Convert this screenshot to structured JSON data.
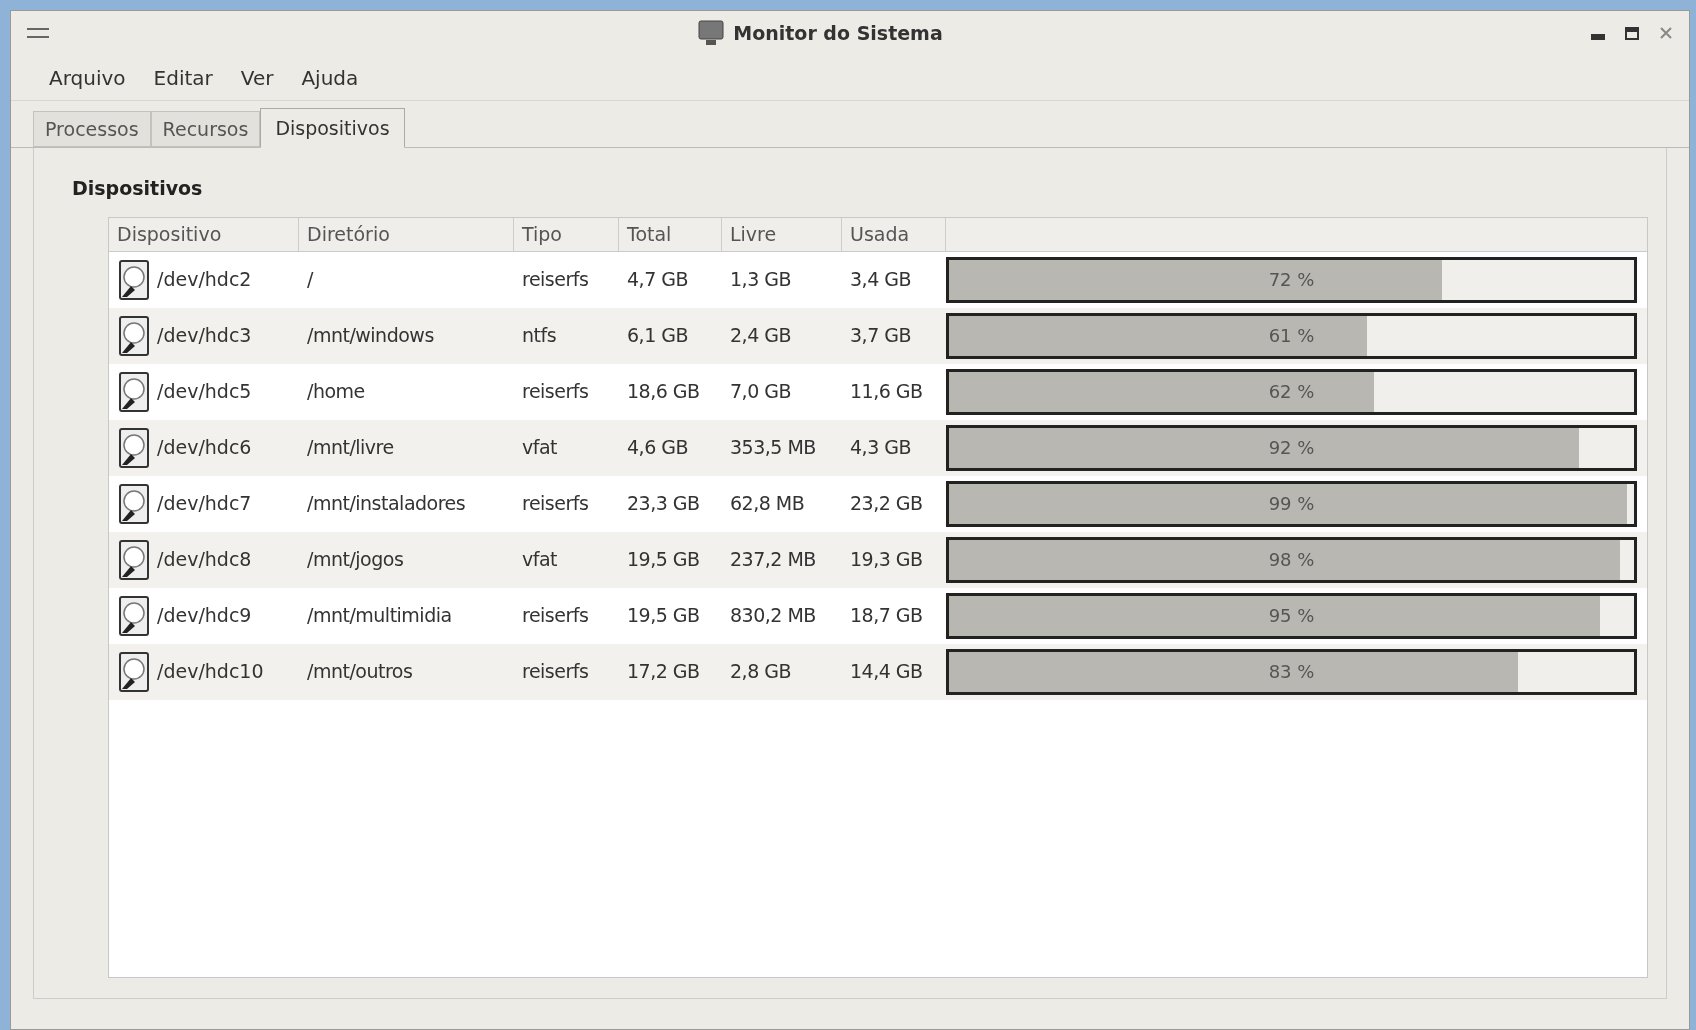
{
  "window": {
    "title": "Monitor do Sistema"
  },
  "menu": [
    "Arquivo",
    "Editar",
    "Ver",
    "Ajuda"
  ],
  "tabs": [
    {
      "label": "Processos",
      "selected": false
    },
    {
      "label": "Recursos",
      "selected": false
    },
    {
      "label": "Dispositivos",
      "selected": true
    }
  ],
  "section_title": "Dispositivos",
  "table": {
    "columns": [
      "Dispositivo",
      "Diretório",
      "Tipo",
      "Total",
      "Livre",
      "Usada"
    ],
    "rows": [
      {
        "device": "/dev/hdc2",
        "directory": "/",
        "type": "reiserfs",
        "total": "4,7 GB",
        "free": "1,3 GB",
        "used": "3,4 GB",
        "level": 0.72,
        "percent": "72 %"
      },
      {
        "device": "/dev/hdc3",
        "directory": "/mnt/windows",
        "type": "ntfs",
        "total": "6,1 GB",
        "free": "2,4 GB",
        "used": "3,7 GB",
        "level": 0.61,
        "percent": "61 %"
      },
      {
        "device": "/dev/hdc5",
        "directory": "/home",
        "type": "reiserfs",
        "total": "18,6 GB",
        "free": "7,0 GB",
        "used": "11,6 GB",
        "level": 0.62,
        "percent": "62 %"
      },
      {
        "device": "/dev/hdc6",
        "directory": "/mnt/livre",
        "type": "vfat",
        "total": "4,6 GB",
        "free": "353,5 MB",
        "used": "4,3 GB",
        "level": 0.92,
        "percent": "92 %"
      },
      {
        "device": "/dev/hdc7",
        "directory": "/mnt/instaladores",
        "type": "reiserfs",
        "total": "23,3 GB",
        "free": "62,8 MB",
        "used": "23,2 GB",
        "level": 0.99,
        "percent": "99 %"
      },
      {
        "device": "/dev/hdc8",
        "directory": "/mnt/jogos",
        "type": "vfat",
        "total": "19,5 GB",
        "free": "237,2 MB",
        "used": "19,3 GB",
        "level": 0.98,
        "percent": "98 %"
      },
      {
        "device": "/dev/hdc9",
        "directory": "/mnt/multimidia",
        "type": "reiserfs",
        "total": "19,5 GB",
        "free": "830,2 MB",
        "used": "18,7 GB",
        "level": 0.95,
        "percent": "95 %"
      },
      {
        "device": "/dev/hdc10",
        "directory": "/mnt/outros",
        "type": "reiserfs",
        "total": "17,2 GB",
        "free": "2,8 GB",
        "used": "14,4 GB",
        "level": 0.83,
        "percent": "83 %"
      }
    ]
  }
}
